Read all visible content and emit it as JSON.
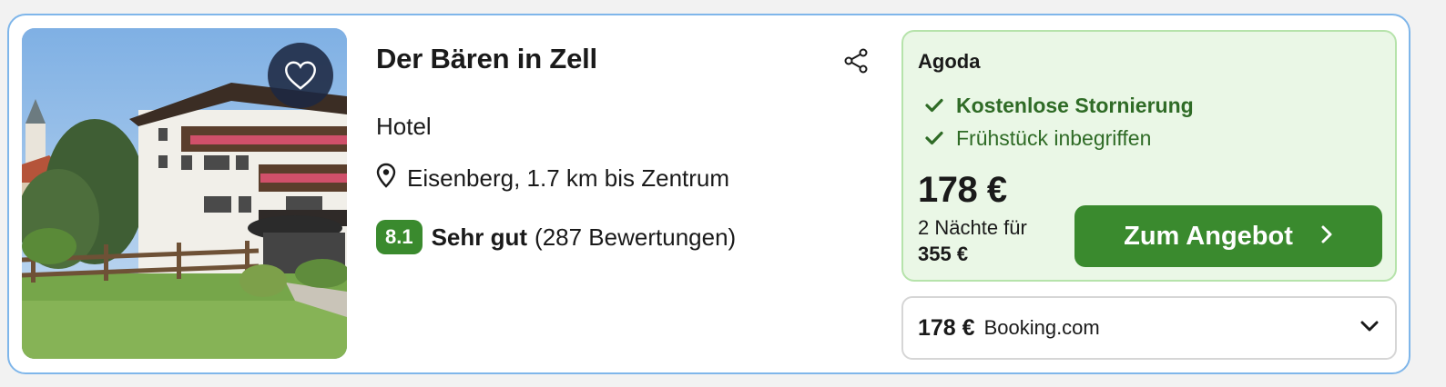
{
  "hotel": {
    "name": "Der Bären in Zell",
    "type": "Hotel",
    "location": "Eisenberg, 1.7 km bis Zentrum",
    "rating": {
      "score": "8.1",
      "label": "Sehr gut",
      "reviews": "(287 Bewertungen)"
    }
  },
  "deal": {
    "provider": "Agoda",
    "features": [
      "Kostenlose Stornierung",
      "Frühstück inbegriffen"
    ],
    "price": "178 €",
    "nights": "2 Nächte für",
    "total": "355 €",
    "cta_label": "Zum Angebot"
  },
  "alt_offer": {
    "price": "178 €",
    "provider": "Booking.com"
  },
  "colors": {
    "accent_green": "#3a8a2e",
    "deal_bg": "#eaf7e6",
    "card_border": "#7fb6ea"
  },
  "icons": {
    "favorite": "heart-icon",
    "share": "share-icon",
    "location": "location-pin-icon",
    "check": "check-icon",
    "cta_arrow": "chevron-right-icon",
    "expand": "chevron-down-icon"
  }
}
